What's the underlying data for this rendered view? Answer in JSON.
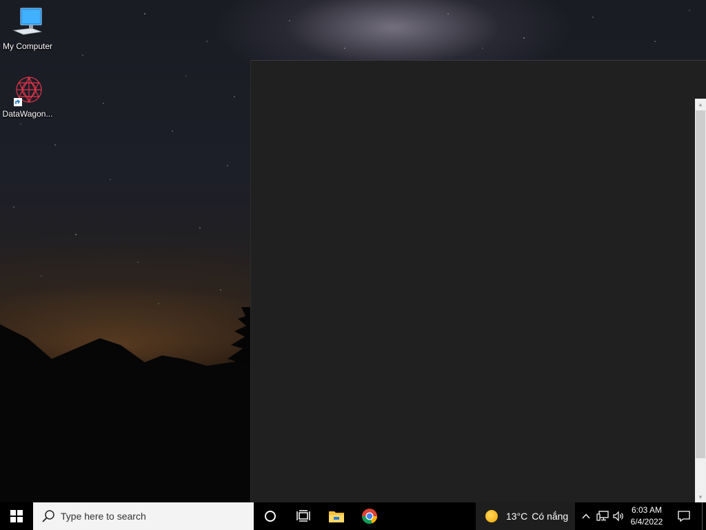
{
  "desktop": {
    "icons": [
      {
        "label": "My Computer",
        "icon": "monitor-icon"
      },
      {
        "label": "DataWagon...",
        "icon": "datawagon-icon"
      }
    ]
  },
  "taskbar": {
    "search_placeholder": "Type here to search",
    "apps": [
      "cortana-icon",
      "task-view-icon",
      "file-explorer-icon",
      "chrome-icon"
    ],
    "weather": {
      "temperature": "13°C",
      "condition": "Có nắng"
    },
    "clock": {
      "time": "6:03 AM",
      "date": "6/4/2022"
    }
  },
  "colors": {
    "window_bg": "#202020",
    "taskbar_bg": "#000000",
    "search_bg": "#f3f3f3"
  }
}
